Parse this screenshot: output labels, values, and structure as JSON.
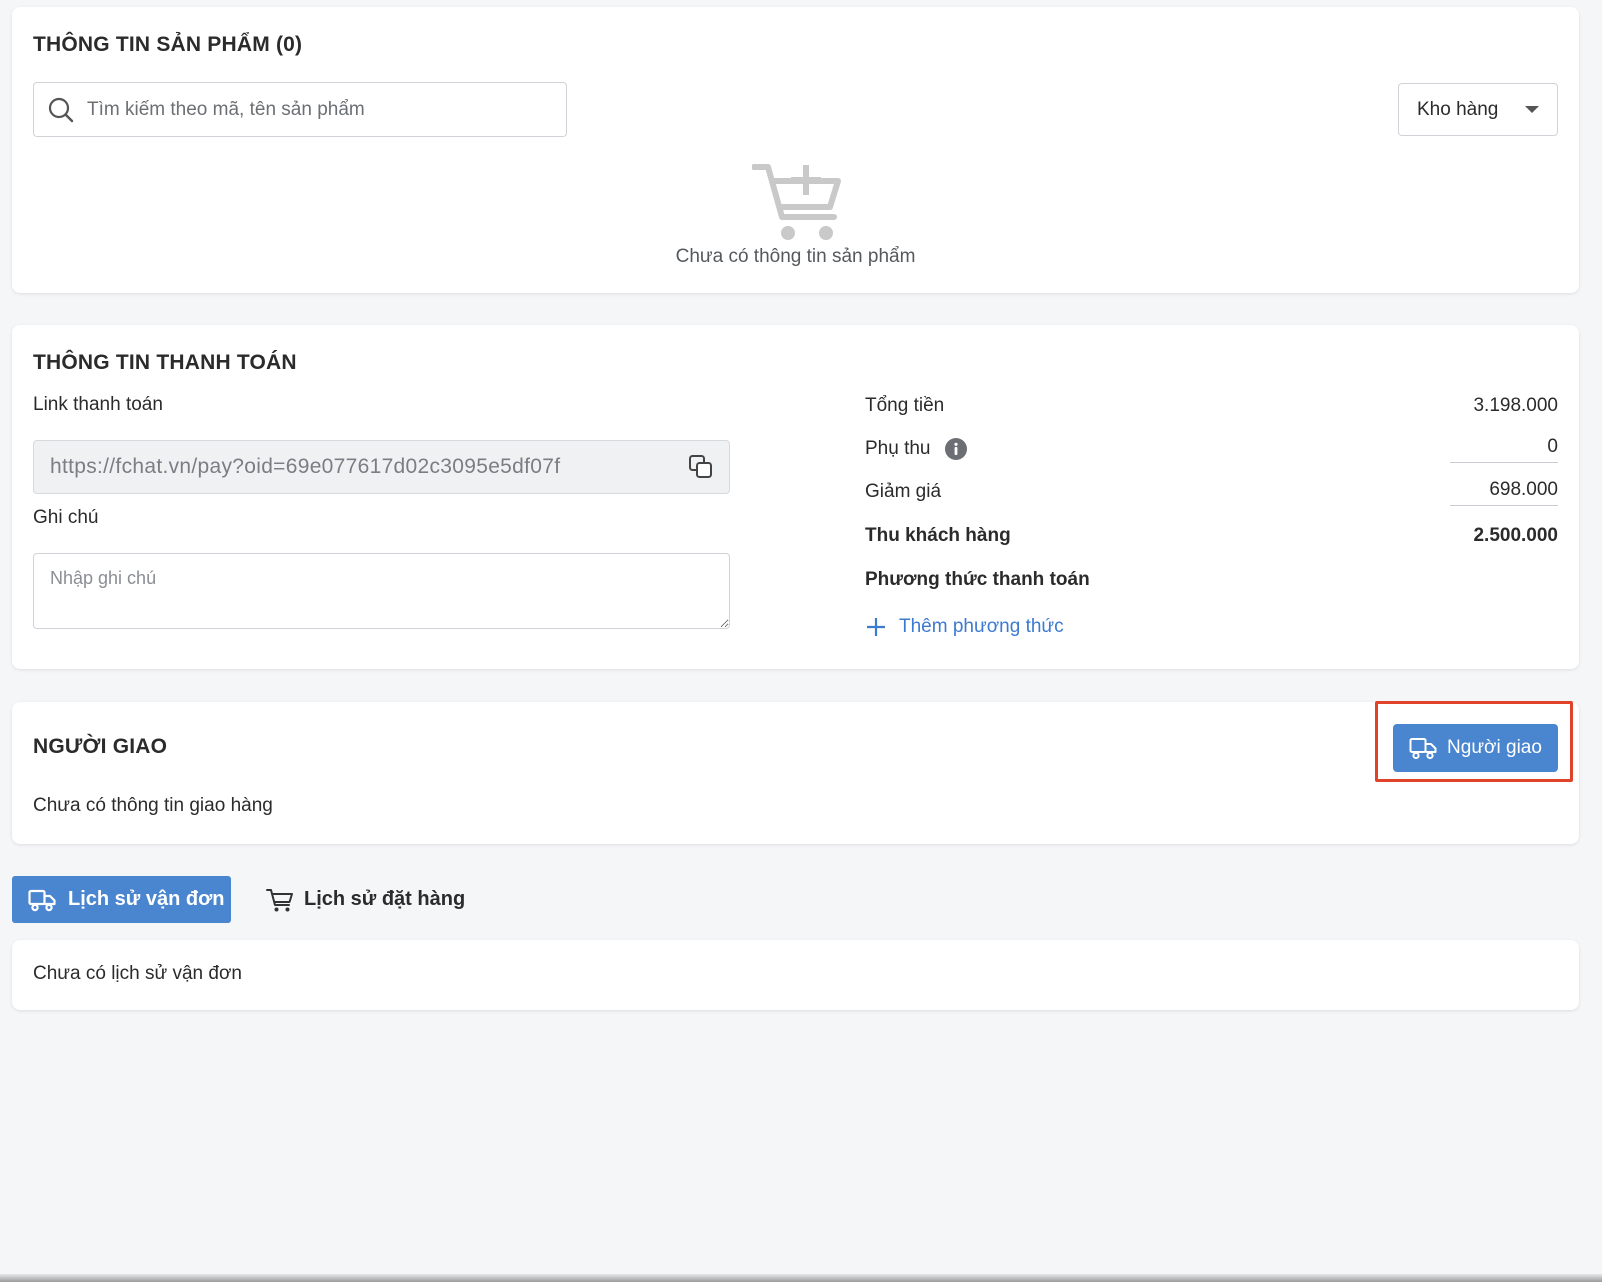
{
  "product": {
    "title": "THÔNG TIN SẢN PHẨM (0)",
    "search_placeholder": "Tìm kiếm theo mã, tên sản phẩm",
    "warehouse_label": "Kho hàng",
    "empty_text": "Chưa có thông tin sản phẩm"
  },
  "payment": {
    "title": "THÔNG TIN THANH TOÁN",
    "link_label": "Link thanh toán",
    "link_value": "https://fchat.vn/pay?oid=69e077617d02c3095e5df07f",
    "note_label": "Ghi chú",
    "note_placeholder": "Nhập ghi chú",
    "total_label": "Tổng tiền",
    "total_value": "3.198.000",
    "surcharge_label": "Phụ thu",
    "surcharge_value": "0",
    "discount_label": "Giảm giá",
    "discount_value": "698.000",
    "collect_label": "Thu khách hàng",
    "collect_value": "2.500.000",
    "method_label": "Phương thức thanh toán",
    "add_method_label": "Thêm phương thức"
  },
  "shipper": {
    "title": "NGƯỜI GIAO",
    "button_label": "Người giao",
    "empty_text": "Chưa có thông tin giao hàng"
  },
  "tabs": {
    "shipping_history": "Lịch sử vận đơn",
    "order_history": "Lịch sử đặt hàng"
  },
  "history": {
    "empty_text": "Chưa có lịch sử vận đơn"
  },
  "colors": {
    "primary": "#4a86cf",
    "link": "#3c7ad1",
    "highlight": "#e0432a",
    "background": "#f5f6f8"
  },
  "icons": [
    "search-icon",
    "chevron-down-icon",
    "cart-plus-icon",
    "copy-icon",
    "info-icon",
    "plus-icon",
    "truck-icon",
    "cart-icon"
  ]
}
